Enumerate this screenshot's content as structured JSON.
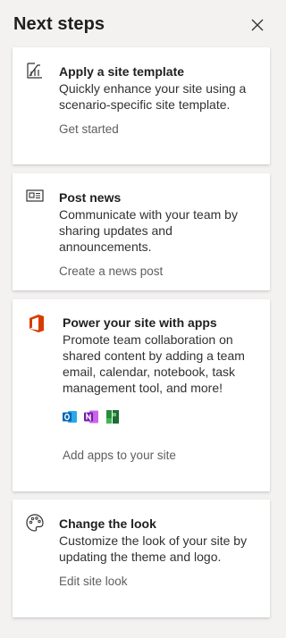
{
  "panel": {
    "title": "Next steps",
    "close_label": "Close"
  },
  "cards": [
    {
      "title": "Apply a site template",
      "description": "Quickly enhance your site using a scenario-specific site template.",
      "link": "Get started",
      "icon": "template-icon"
    },
    {
      "title": "Post news",
      "description": "Communicate with your team by sharing updates and announcements.",
      "link": "Create a news post",
      "icon": "news-icon"
    },
    {
      "title": "Power your site with apps",
      "description": "Promote team collaboration on shared content by adding a team email, calendar, notebook, task management tool, and more!",
      "link": "Add apps to your site",
      "icon": "office-icon",
      "apps": [
        "outlook-icon",
        "onenote-icon",
        "planner-icon"
      ]
    },
    {
      "title": "Change the look",
      "description": "Customize the look of your site by updating the theme and logo.",
      "link": "Edit site look",
      "icon": "palette-icon"
    }
  ],
  "colors": {
    "background": "#f3f2f1",
    "card": "#ffffff",
    "title_text": "#201f1e",
    "body_text": "#323130",
    "link_text": "#605e5c",
    "office_red": "#d83b01",
    "outlook_blue": "#0364b8",
    "onenote_purple": "#7719aa",
    "planner_green": "#2a8a3e"
  }
}
